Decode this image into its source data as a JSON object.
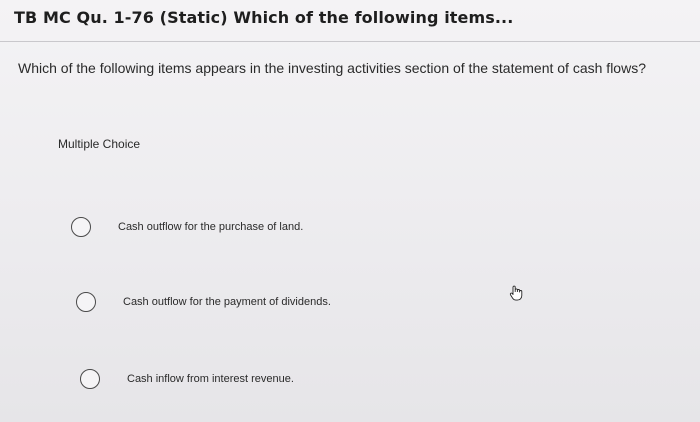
{
  "header": {
    "title": "TB MC Qu. 1-76 (Static) Which of the following items..."
  },
  "question": {
    "text": "Which of the following items appears in the investing activities section of the statement of cash flows?",
    "type_label": "Multiple Choice"
  },
  "options": [
    {
      "label": "Cash outflow for the purchase of land."
    },
    {
      "label": "Cash outflow for the payment of dividends."
    },
    {
      "label": "Cash inflow from interest revenue."
    }
  ],
  "cursor": {
    "icon": "hand-pointer-icon"
  }
}
